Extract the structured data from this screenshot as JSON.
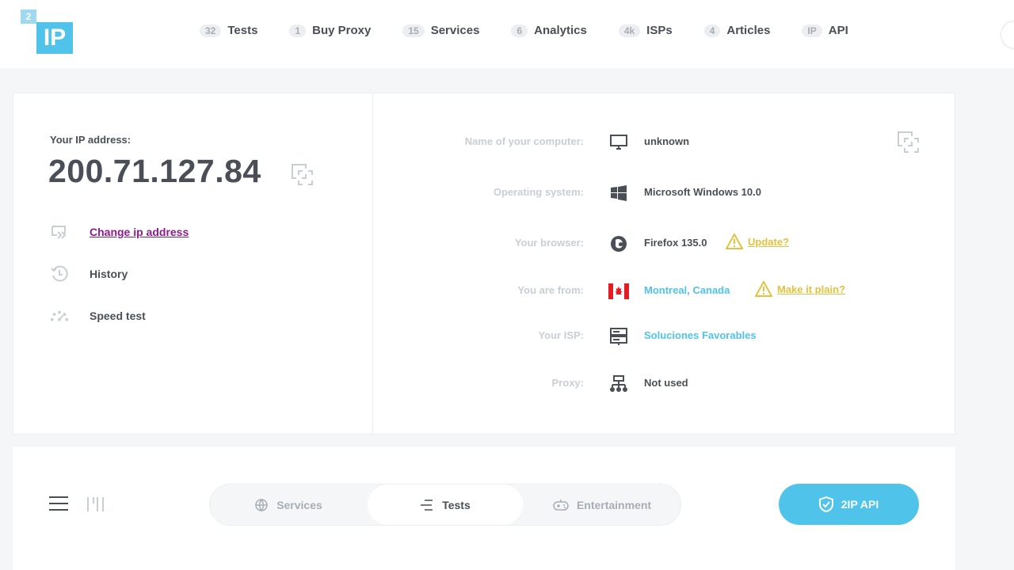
{
  "logo": {
    "small": "2",
    "big": "IP"
  },
  "nav": [
    {
      "badge": "32",
      "label": "Tests"
    },
    {
      "badge": "1",
      "label": "Buy Proxy"
    },
    {
      "badge": "15",
      "label": "Services"
    },
    {
      "badge": "6",
      "label": "Analytics"
    },
    {
      "badge": "4k",
      "label": "ISPs"
    },
    {
      "badge": "4",
      "label": "Articles"
    },
    {
      "badge": "IP",
      "label": "API"
    }
  ],
  "ip": {
    "label": "Your IP address:",
    "value": "200.71.127.84"
  },
  "left_links": {
    "change": "Change ip address",
    "history": "History",
    "speed": "Speed test"
  },
  "info": {
    "computer": {
      "key": "Name of your computer:",
      "value": "unknown"
    },
    "os": {
      "key": "Operating system:",
      "value": "Microsoft Windows 10.0"
    },
    "browser": {
      "key": "Your browser:",
      "value": "Firefox 135.0",
      "warn": "Update?"
    },
    "location": {
      "key": "You are from:",
      "value": "Montreal, Canada",
      "warn": "Make it plain?"
    },
    "isp": {
      "key": "Your ISP:",
      "value": "Soluciones Favorables"
    },
    "proxy": {
      "key": "Proxy:",
      "value": "Not used"
    }
  },
  "tabs": {
    "services": "Services",
    "tests": "Tests",
    "entertainment": "Entertainment"
  },
  "api_button": "2IP API",
  "colors": {
    "accent": "#4fc3ea",
    "warning": "#e2c23e",
    "link_purple": "#8e1a8e",
    "flag_red": "#e51c23"
  }
}
